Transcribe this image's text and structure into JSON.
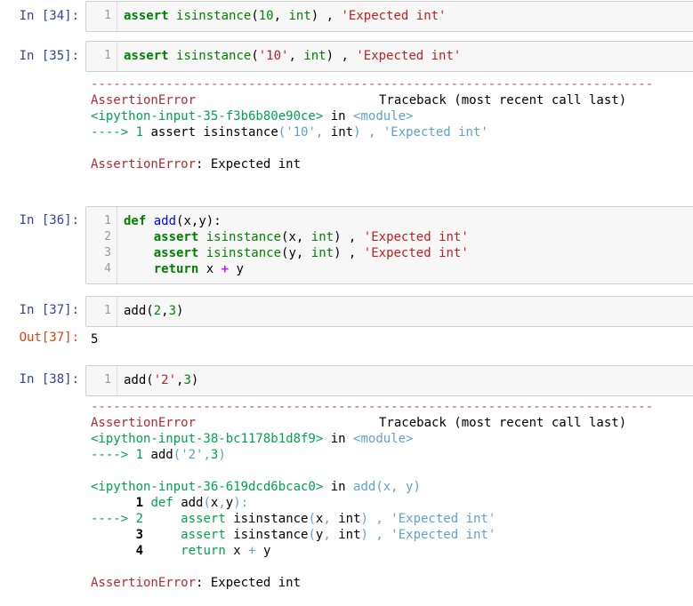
{
  "cells": {
    "c34": {
      "prompt": "In [34]:",
      "ln": "1"
    },
    "c35": {
      "prompt": "In [35]:",
      "ln": "1"
    },
    "c36": {
      "prompt": "In [36]:",
      "ln": [
        "1",
        "2",
        "3",
        "4"
      ]
    },
    "c37": {
      "prompt": "In [37]:",
      "ln": "1",
      "out_prompt": "Out[37]:",
      "out_value": "5"
    },
    "c38": {
      "prompt": "In [38]:",
      "ln": "1"
    }
  },
  "tok": {
    "assert": "assert",
    "isinstance": "isinstance",
    "int": "int",
    "def": "def",
    "return": "return",
    "add": "add",
    "in": "in",
    "n10": "10",
    "n2": "2",
    "n3": "3",
    "s10": "'10'",
    "s2": "'2'",
    "sExpected": "'Expected int'",
    "x": "x",
    "y": "y",
    "plus": "+"
  },
  "errors": {
    "dashes": "---------------------------------------------------------------------------",
    "error_name": "AssertionError",
    "traceback_header": "Traceback (most recent call last)",
    "final_message": "Expected int",
    "e35": {
      "location": "<ipython-input-35-f3b6b80e90ce>",
      "module": "<module>",
      "arrow": "----> 1"
    },
    "e38": {
      "location1": "<ipython-input-38-bc1178b1d8f9>",
      "module": "<module>",
      "arrow1": "----> 1",
      "location2": "<ipython-input-36-619dcd6bcac0>",
      "func_sig": "add(x, y)",
      "ln1": "1",
      "arrow2": "----> 2",
      "ln3": "3",
      "ln4": "4"
    }
  }
}
